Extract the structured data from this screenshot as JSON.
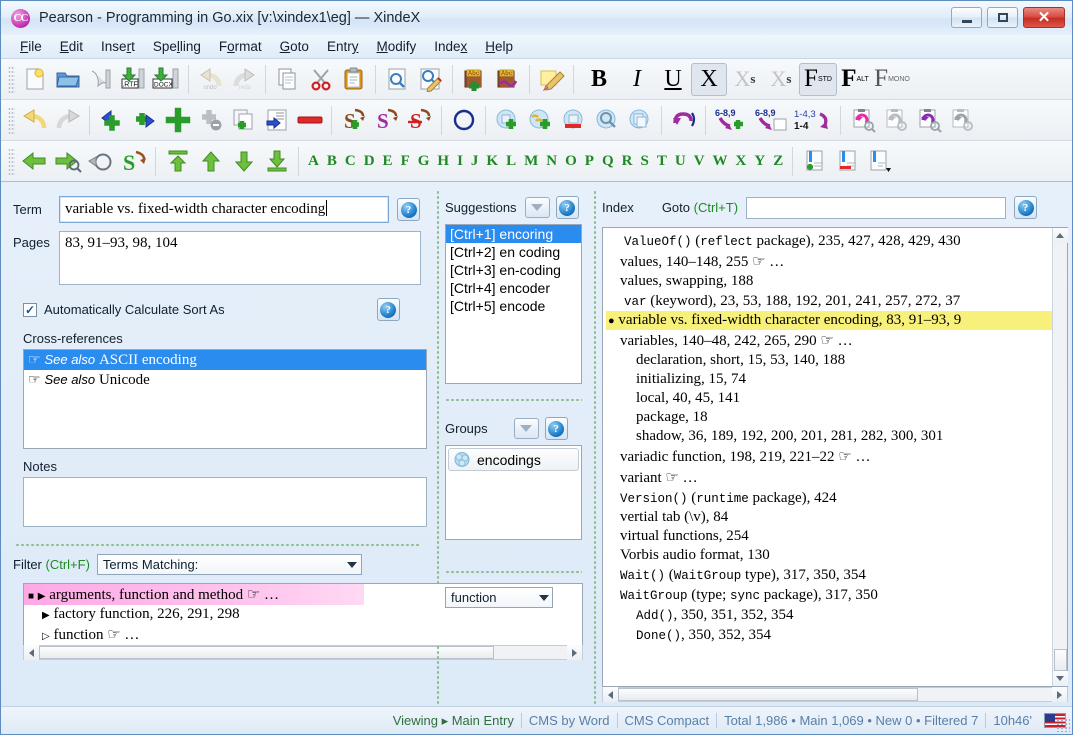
{
  "window": {
    "title": "Pearson - Programming in Go.xix [v:\\xindex1\\eg] — XindeX",
    "logo_text": "CC",
    "minimize": "—",
    "maximize": "□",
    "close": "✕"
  },
  "menu": {
    "items": [
      {
        "label": "File"
      },
      {
        "label": "Edit"
      },
      {
        "label": "Insert"
      },
      {
        "label": "Spelling"
      },
      {
        "label": "Format"
      },
      {
        "label": "Goto"
      },
      {
        "label": "Entry"
      },
      {
        "label": "Modify"
      },
      {
        "label": "Index"
      },
      {
        "label": "Help"
      }
    ]
  },
  "toolbar": {
    "alphabet": [
      "A",
      "B",
      "C",
      "D",
      "E",
      "F",
      "G",
      "H",
      "I",
      "J",
      "K",
      "L",
      "M",
      "N",
      "O",
      "P",
      "Q",
      "R",
      "S",
      "T",
      "U",
      "V",
      "W",
      "X",
      "Y",
      "Z"
    ],
    "row1_icons": [
      "new-document-icon",
      "open-folder-icon",
      "save-icon",
      "export-rtf-icon",
      "export-docx-icon",
      "undo-icon",
      "redo-icon",
      "copy-icon",
      "cut-scissors-icon",
      "paste-clipboard-icon",
      "preview-icon",
      "preview-edit-icon",
      "add-dictionary-icon",
      "edit-dictionary-icon",
      "notes-pencil-icon"
    ],
    "row1_format": [
      "bold-button",
      "italic-button",
      "underline-button",
      "normal-x-button",
      "superscript-button",
      "subscript-button",
      "font-std-button",
      "font-alt-button",
      "font-mono-button"
    ],
    "row2_icons": [
      "undo-entry-icon",
      "redo-entry-icon",
      "add-subentry-left-icon",
      "add-subentry-right-icon",
      "add-entry-icon",
      "remove-dup-icon",
      "duplicate-entry-icon",
      "move-entry-icon",
      "delete-entry-icon",
      "add-crossref-icon",
      "edit-crossref-icon",
      "delete-crossref-icon",
      "circle-icon",
      "add-group-icon",
      "link-group-icon",
      "remove-group-icon",
      "find-group-icon",
      "groups-icon",
      "swap-icon",
      "add-pagerange-icon",
      "pagerange-doc-icon",
      "renumber-icon",
      "refresh-pink-icon",
      "refresh-grey-icon",
      "refresh-purple-icon",
      "refresh-dark-icon"
    ],
    "row3_icons": [
      "back-arrow-icon",
      "forward-search-icon",
      "undo-circle-icon",
      "redo-s-icon",
      "move-top-icon",
      "move-up-icon",
      "move-down-icon",
      "move-bottom-icon",
      "add-bookmark-icon",
      "remove-bookmark-icon",
      "bookmark-menu-icon"
    ],
    "format_labels": {
      "bold": "B",
      "italic": "I",
      "underline": "U",
      "normal": "X",
      "superscript": "X",
      "superscript_sup": "s",
      "subscript": "X",
      "subscript_sub": "s",
      "font_std": "F",
      "font_std_sub": "STD",
      "font_alt": "F",
      "font_alt_sub": "ALT",
      "font_mono": "F",
      "font_mono_sub": "MONO"
    },
    "rtf_label": ".RTF",
    "docx_label": ".DOCX",
    "pagerange_a": "6-8,9",
    "pagerange_b": "6-8,9",
    "pagerange_c1": "1-4,3",
    "pagerange_c2": "1-4",
    "dict_label": "Abc"
  },
  "entry_panel": {
    "term_label": "Term",
    "term_value": "variable vs. fixed-width character encoding",
    "pages_label": "Pages",
    "pages_value": "83, 91–93, 98, 104",
    "auto_sort_label": "Automatically Calculate Sort As",
    "auto_sort_checked": "✓",
    "crossrefs_label": "Cross-references",
    "crossrefs": [
      {
        "prefix": "See also",
        "text": "ASCII encoding",
        "selected": true
      },
      {
        "prefix": "See also",
        "text": "Unicode",
        "selected": false
      }
    ],
    "notes_label": "Notes",
    "notes_value": ""
  },
  "suggestions": {
    "label": "Suggestions",
    "items": [
      {
        "key": "[Ctrl+1]",
        "text": "encoring",
        "selected": true
      },
      {
        "key": "[Ctrl+2]",
        "text": "en coding",
        "selected": false
      },
      {
        "key": "[Ctrl+3]",
        "text": "en-coding",
        "selected": false
      },
      {
        "key": "[Ctrl+4]",
        "text": "encoder",
        "selected": false
      },
      {
        "key": "[Ctrl+5]",
        "text": "encode",
        "selected": false
      }
    ]
  },
  "groups": {
    "label": "Groups",
    "items": [
      {
        "text": "encodings"
      }
    ]
  },
  "index_panel": {
    "label": "Index",
    "goto_label": "Goto (Ctrl+T)",
    "goto_value": "",
    "entries": [
      {
        "indent": 1,
        "mono_prefix": "ValueOf()",
        "paren": "(",
        "mono_mid": "reflect",
        "text": " package), 235, 427, 428, 429, 430",
        "highlight": false
      },
      {
        "indent": 1,
        "text": "values, 140–148, 255 ☞ …",
        "highlight": false
      },
      {
        "indent": 1,
        "text": "values, swapping, 188",
        "highlight": false
      },
      {
        "indent": 1,
        "mono_prefix": "var",
        "text": " (keyword), 23, 53, 188, 192, 201, 241, 257, 272, 37",
        "highlight": false
      },
      {
        "indent": 0,
        "bullet": "●",
        "text": "variable vs. fixed-width character encoding, 83, 91–93, 9",
        "highlight": true
      },
      {
        "indent": 1,
        "text": "variables, 140–48, 242, 265, 290 ☞ …",
        "highlight": false
      },
      {
        "indent": 2,
        "text": "declaration, short, 15, 53, 140, 188",
        "highlight": false
      },
      {
        "indent": 2,
        "text": "initializing, 15, 74",
        "highlight": false
      },
      {
        "indent": 2,
        "text": "local, 40, 45, 141",
        "highlight": false
      },
      {
        "indent": 2,
        "text": "package, 18",
        "highlight": false
      },
      {
        "indent": 2,
        "text": "shadow, 36, 189, 192, 200, 201, 281, 282, 300, 301",
        "highlight": false
      },
      {
        "indent": 1,
        "text": "variadic function, 198, 219, 221–22 ☞ …",
        "highlight": false
      },
      {
        "indent": 1,
        "text": "variant ☞ …",
        "highlight": false
      },
      {
        "indent": 1,
        "mono_prefix": "Version()",
        "paren": "(",
        "mono_mid": "runtime",
        "text": " package), 424",
        "highlight": false
      },
      {
        "indent": 1,
        "text": "vertial tab (\\v), 84",
        "highlight": false
      },
      {
        "indent": 1,
        "text": "virtual functions, 254",
        "highlight": false
      },
      {
        "indent": 1,
        "text": "Vorbis audio format, 130",
        "highlight": false
      },
      {
        "indent": 1,
        "mono_prefix": "Wait()",
        "paren": "(",
        "mono_mid": "WaitGroup",
        "text": " type), 317, 350, 354",
        "highlight": false
      },
      {
        "indent": 1,
        "mono_prefix": "WaitGroup",
        "paren": "(type; ",
        "mono_mid": "sync",
        "text": " package), 317, 350",
        "highlight": false
      },
      {
        "indent": 2,
        "mono_prefix": "Add()",
        "text": ", 350, 351, 352, 354",
        "highlight": false
      },
      {
        "indent": 2,
        "mono_prefix": "Done()",
        "text": ", 350, 352, 354",
        "highlight": false
      }
    ]
  },
  "filter": {
    "label": "Filter (Ctrl+F)",
    "mode_value": "Terms Matching:",
    "text_value": "function",
    "results": [
      {
        "marker": "■",
        "arrow": "▶",
        "text": "arguments, function and method ☞ …",
        "highlight": true,
        "indent": 0
      },
      {
        "marker": "",
        "arrow": "▶",
        "text": "factory function, 226, 291, 298",
        "highlight": false,
        "indent": 1
      },
      {
        "marker": "",
        "arrow": "▷",
        "text": "function ☞ …",
        "highlight": false,
        "indent": 1
      }
    ]
  },
  "statusbar": {
    "segments": [
      {
        "text": "Viewing ▸ Main Entry",
        "first": true
      },
      {
        "text": "CMS by Word",
        "first": false
      },
      {
        "text": "CMS Compact",
        "first": false
      },
      {
        "text": "Total 1,986 • Main 1,069 • New 0 • Filtered 7",
        "first": false
      },
      {
        "text": "10h46'",
        "first": false
      }
    ],
    "flag": "us-flag-icon"
  },
  "colors": {
    "accent_blue": "#2b8cf0",
    "highlight_yellow": "#f7f07a",
    "highlight_pink": "#ffa8e6",
    "green_letters": "#1f8a23",
    "close_red": "#d9463a"
  }
}
